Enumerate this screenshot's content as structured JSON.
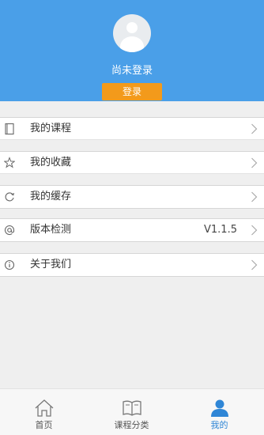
{
  "profile": {
    "status": "尚未登录",
    "login_label": "登录"
  },
  "menu": {
    "items": [
      {
        "label": "我的课程",
        "icon": "document-icon"
      },
      {
        "label": "我的收藏",
        "icon": "star-icon"
      },
      {
        "label": "我的缓存",
        "icon": "refresh-icon"
      },
      {
        "label": "版本检测",
        "icon": "at-icon",
        "value": "V1.1.5"
      },
      {
        "label": "关于我们",
        "icon": "info-icon"
      }
    ]
  },
  "tabs": [
    {
      "label": "首页",
      "icon": "home-icon",
      "active": false
    },
    {
      "label": "课程分类",
      "icon": "book-icon",
      "active": false
    },
    {
      "label": "我的",
      "icon": "user-icon",
      "active": true
    }
  ],
  "colors": {
    "header": "#4a9fe8",
    "login_button": "#f39a1b",
    "active_tab": "#2f86d6"
  }
}
